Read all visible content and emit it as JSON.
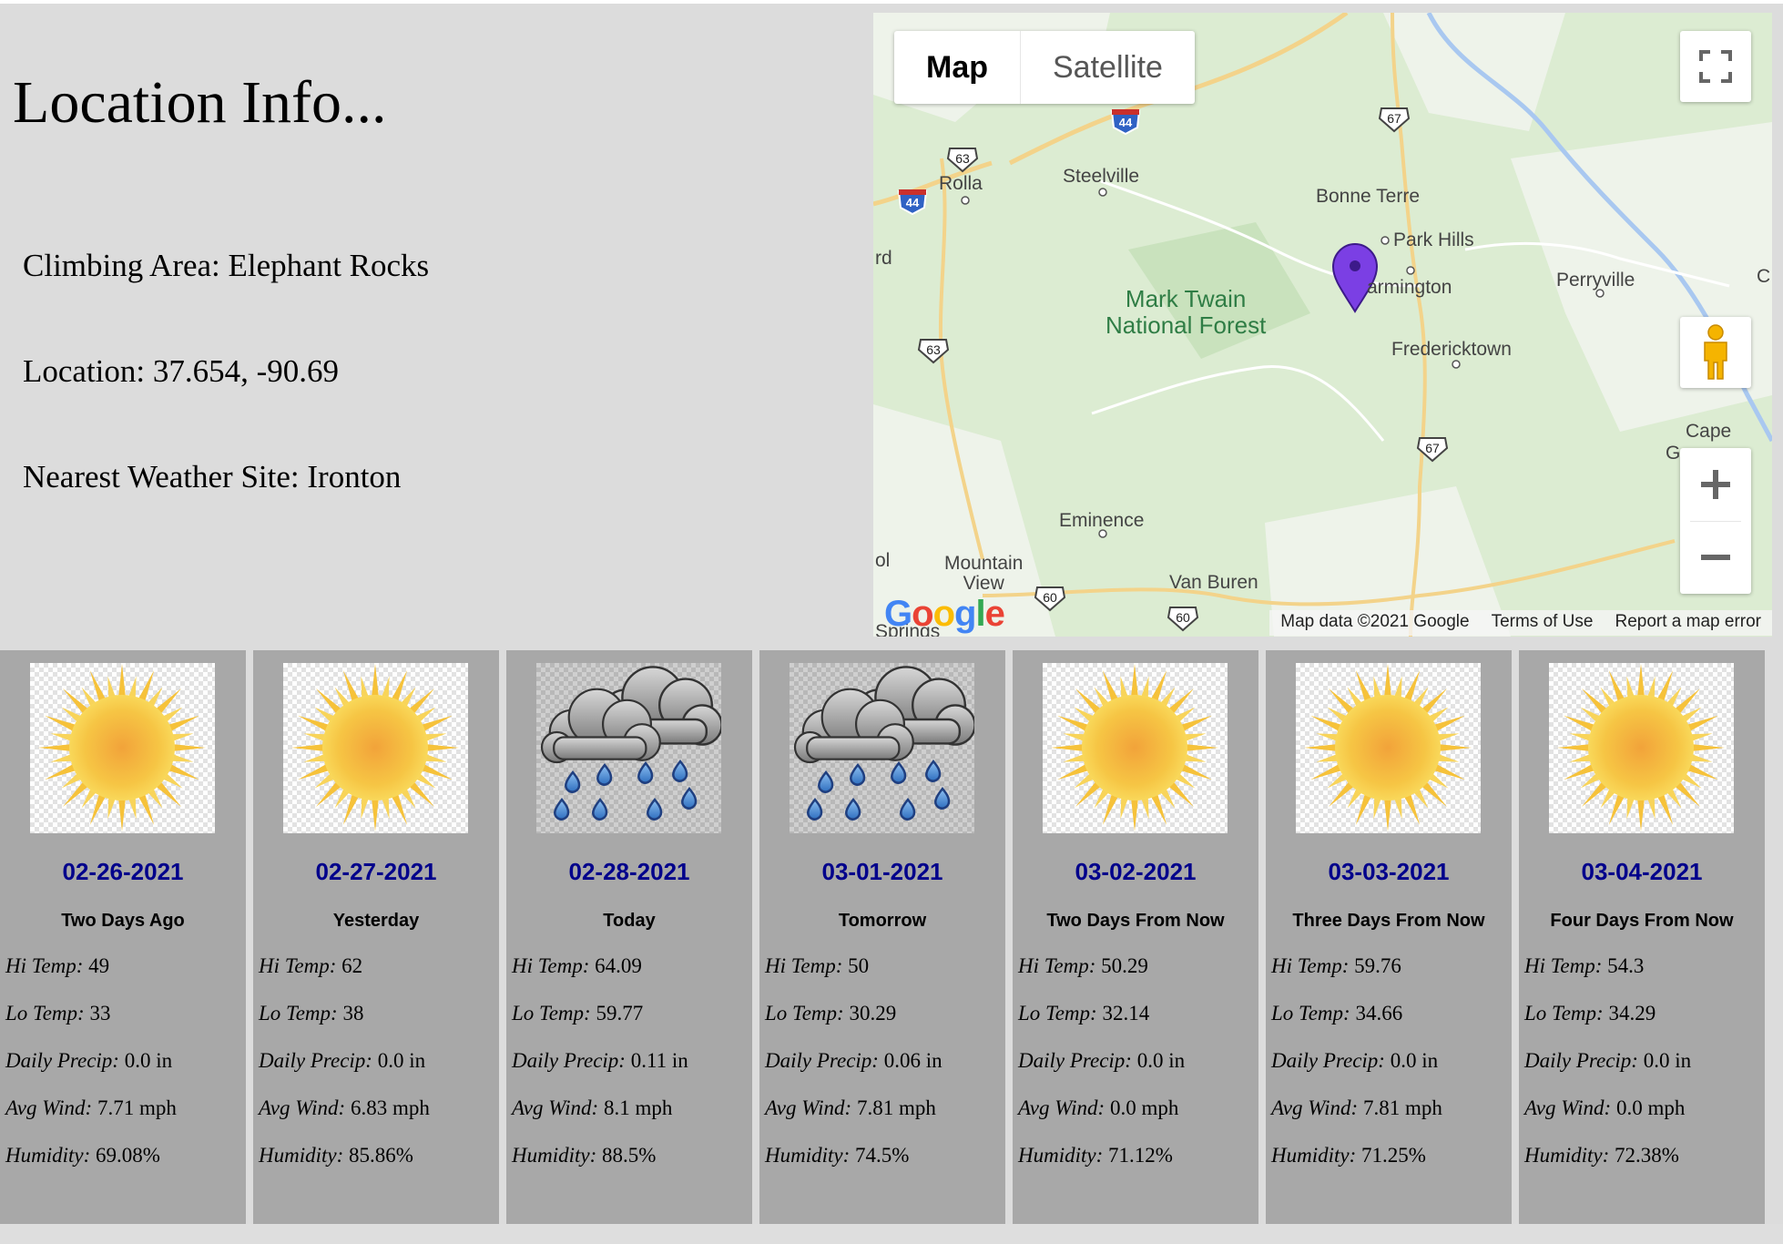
{
  "info": {
    "heading": "Location Info...",
    "climbing_area": "Climbing Area: Elephant Rocks",
    "location": "Location: 37.654, -90.69",
    "weather_site": "Nearest Weather Site: Ironton"
  },
  "map": {
    "type_buttons": {
      "map": "Map",
      "satellite": "Satellite"
    },
    "towns": {
      "rolla": "Rolla",
      "steelville": "Steelville",
      "bonne_terre": "Bonne Terre",
      "park_hills": "Park Hills",
      "farmington": "armington",
      "perryville": "Perryville",
      "fredericktown": "Fredericktown",
      "cape": "Cape",
      "eminence": "Eminence",
      "mountain_view": "Mountain\nView",
      "van_buren": "Van Buren",
      "rd": "rd",
      "ol": "ol",
      "c": "C",
      "g": "G",
      "springs": "Springs"
    },
    "forest": "Mark Twain\nNational Forest",
    "shields": {
      "i44a": "44",
      "i44b": "44",
      "us63a": "63",
      "us63b": "63",
      "us67a": "67",
      "us67b": "67",
      "us60a": "60",
      "us60b": "60"
    },
    "logo": "Google",
    "attribution": {
      "data": "Map data ©2021 Google",
      "terms": "Terms of Use",
      "report": "Report a map error"
    }
  },
  "days": [
    {
      "date": "02-26-2021",
      "label": "Two Days Ago",
      "icon": "sun-icon",
      "hi": "49",
      "lo": "33",
      "precip": "0.0 in",
      "wind": "7.71 mph",
      "humidity": "69.08%"
    },
    {
      "date": "02-27-2021",
      "label": "Yesterday",
      "icon": "sun-icon",
      "hi": "62",
      "lo": "38",
      "precip": "0.0 in",
      "wind": "6.83 mph",
      "humidity": "85.86%"
    },
    {
      "date": "02-28-2021",
      "label": "Today",
      "icon": "rain-cloud-icon",
      "hi": "64.09",
      "lo": "59.77",
      "precip": "0.11 in",
      "wind": "8.1 mph",
      "humidity": "88.5%"
    },
    {
      "date": "03-01-2021",
      "label": "Tomorrow",
      "icon": "rain-cloud-icon",
      "hi": "50",
      "lo": "30.29",
      "precip": "0.06 in",
      "wind": "7.81 mph",
      "humidity": "74.5%"
    },
    {
      "date": "03-02-2021",
      "label": "Two Days From Now",
      "icon": "sun-icon",
      "hi": "50.29",
      "lo": "32.14",
      "precip": "0.0 in",
      "wind": "0.0 mph",
      "humidity": "71.12%"
    },
    {
      "date": "03-03-2021",
      "label": "Three Days From Now",
      "icon": "sun-icon",
      "hi": "59.76",
      "lo": "34.66",
      "precip": "0.0 in",
      "wind": "7.81 mph",
      "humidity": "71.25%"
    },
    {
      "date": "03-04-2021",
      "label": "Four Days From Now",
      "icon": "sun-icon",
      "hi": "54.3",
      "lo": "34.29",
      "precip": "0.0 in",
      "wind": "0.0 mph",
      "humidity": "72.38%"
    }
  ],
  "stat_labels": {
    "hi": "Hi Temp:",
    "lo": "Lo Temp:",
    "precip": "Daily Precip:",
    "wind": "Avg Wind:",
    "humidity": "Humidity:"
  },
  "colors": {
    "page_bg": "#dcdcdc",
    "card_bg": "#a8a8a8",
    "date_text": "#00008b",
    "marker": "#7b3fe4"
  }
}
